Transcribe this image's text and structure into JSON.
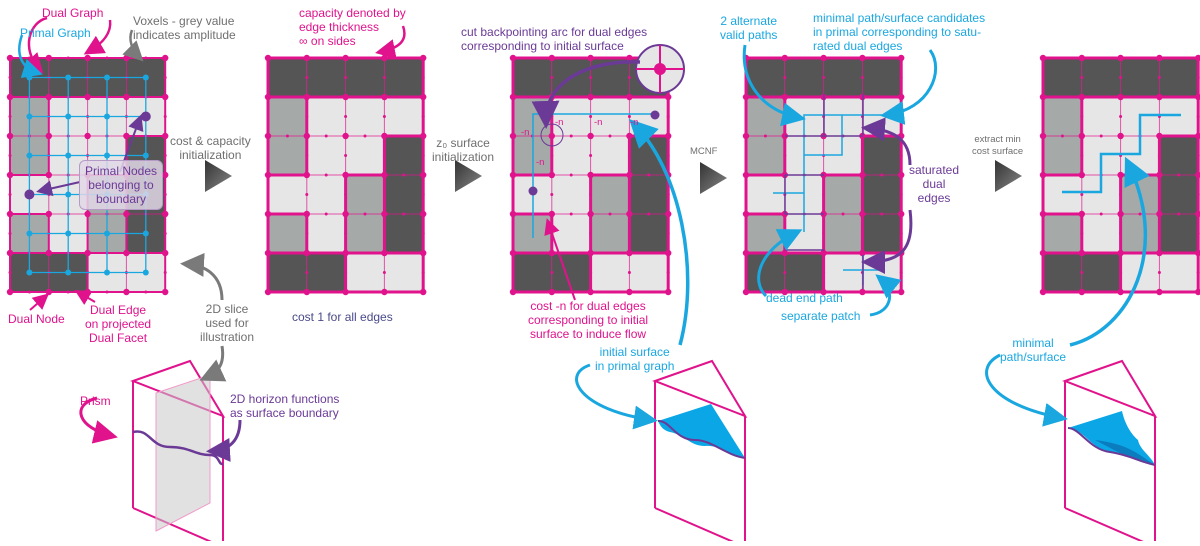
{
  "colors": {
    "dual_graph": "#e0138c",
    "primal_graph": "#1aa7e0",
    "boundary": "#6b3a96",
    "voxel_dark": "#555555",
    "voxel_medium": "#a5aaa9",
    "voxel_light": "#e6e6e6",
    "arrow_grey": "#6f6f6f",
    "surface_fill": "#0aa6e6",
    "surface_shade": "#0b7dbf"
  },
  "voxel_grid": {
    "columns": 4,
    "rows": 6,
    "shades": [
      [
        "D",
        "D",
        "D",
        "D"
      ],
      [
        "M",
        "L",
        "L",
        "L"
      ],
      [
        "M",
        "L",
        "L",
        "D"
      ],
      [
        "L",
        "L",
        "M",
        "D"
      ],
      [
        "M",
        "L",
        "M",
        "D"
      ],
      [
        "D",
        "D",
        "L",
        "L"
      ]
    ]
  },
  "panel1": {
    "label_dual_graph": "Dual Graph",
    "label_primal_graph": "Primal Graph",
    "label_voxels": "Voxels - grey value\nindicates amplitude",
    "tooltip_primal_nodes": "Primal Nodes\nbelonging to\nboundary",
    "label_dual_node": "Dual Node",
    "label_dual_edge": "Dual Edge\non projected\nDual Facet",
    "label_slice": "2D slice\nused for\nillustration",
    "label_prism": "Prism",
    "label_horizon": "2D horizon functions\nas surface boundary"
  },
  "step1": {
    "label": "cost & capacity\ninitialization",
    "icon": "play-triangle"
  },
  "panel2": {
    "label_capacity": "capacity denoted by\nedge thickness\n∞ on sides",
    "label_cost": "cost 1 for all edges"
  },
  "step2": {
    "label": "z₀ surface\ninitialization",
    "icon": "play-triangle"
  },
  "panel3": {
    "label_cut": "cut backpointing arc for dual edges\ncorresponding to initial surface",
    "edge_cost_label": "-n",
    "label_cost_n": "cost -n for dual edges\ncorresponding to initial\nsurface to induce flow",
    "label_initial_surface": "initial surface\nin primal graph"
  },
  "step3": {
    "label": "MCNF",
    "icon": "play-triangle"
  },
  "panel4": {
    "label_alternate": "2 alternate\nvalid paths",
    "label_candidates": "minimal path/surface candidates\nin primal corresponding to satu-\nrated dual edges",
    "label_saturated": "saturated\ndual\nedges",
    "label_dead_end": "dead end path",
    "label_separate": "separate patch"
  },
  "step4": {
    "label": "extract min\ncost surface",
    "icon": "play-triangle"
  },
  "panel5": {
    "label_minimal": "minimal\npath/surface"
  }
}
